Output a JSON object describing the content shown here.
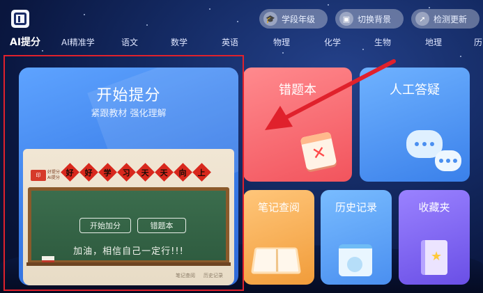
{
  "header": {
    "logo_text": "Ai提分",
    "buttons": [
      {
        "label": "学段年级",
        "icon": "graduation-cap-icon"
      },
      {
        "label": "切换背景",
        "icon": "swap-image-icon"
      },
      {
        "label": "检测更新",
        "icon": "rocket-icon"
      }
    ]
  },
  "tabs": [
    {
      "label": "AI提分"
    },
    {
      "label": "AI精准学"
    },
    {
      "label": "语文"
    },
    {
      "label": "数学"
    },
    {
      "label": "英语"
    },
    {
      "label": "物理"
    },
    {
      "label": "化学"
    },
    {
      "label": "生物"
    },
    {
      "label": "地理"
    },
    {
      "label": "历"
    }
  ],
  "main_card": {
    "title": "开始提分",
    "subtitle": "紧跟教材 强化理解",
    "banner_chars": [
      "好",
      "好",
      "学",
      "习",
      "天",
      "天",
      "向",
      "上"
    ],
    "mini_logo": "印",
    "mini_logo_text": "好提分 AI提分",
    "board_buttons": [
      "开始加分",
      "错题本"
    ],
    "board_text": "加油，相信自己一定行!!!",
    "footer_links": [
      "笔记查阅",
      "历史记录"
    ]
  },
  "cards": {
    "mistakes": "错题本",
    "qa": "人工答疑",
    "notes": "笔记查阅",
    "history": "历史记录",
    "favorites": "收藏夹"
  },
  "colors": {
    "highlight_border": "#e0212c",
    "arrow": "#e0212c"
  }
}
